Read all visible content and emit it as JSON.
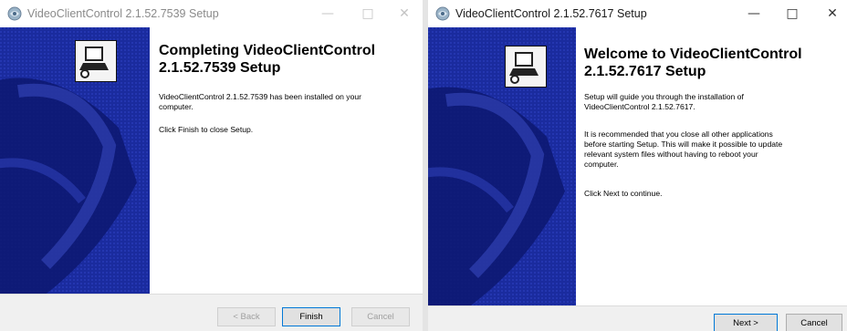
{
  "left_window": {
    "title": "VideoClientControl 2.1.52.7539 Setup",
    "minimize": "—",
    "maximize": "□",
    "close": "✕",
    "heading_line1": "Completing VideoClientControl",
    "heading_line2": "2.1.52.7539 Setup",
    "paragraph1_line1": "VideoClientControl 2.1.52.7539 has been installed on your",
    "paragraph1_line2": "computer.",
    "paragraph2": "Click Finish to close Setup.",
    "back_button": "< Back",
    "finish_button": "Finish",
    "cancel_button": "Cancel"
  },
  "right_window": {
    "title": "VideoClientControl 2.1.52.7617 Setup",
    "minimize": "—",
    "maximize": "□",
    "close": "✕",
    "heading_line1": "Welcome to VideoClientControl",
    "heading_line2": "2.1.52.7617 Setup",
    "paragraph1_line1": "Setup will guide you through the installation of",
    "paragraph1_line2": "VideoClientControl 2.1.52.7617.",
    "paragraph2_line1": "It is recommended that you close all other applications",
    "paragraph2_line2": "before starting Setup. This will make it possible to update",
    "paragraph2_line3": "relevant system files without having to reboot your",
    "paragraph2_line4": "computer.",
    "paragraph3": "Click Next to continue.",
    "next_button": "Next >",
    "cancel_button": "Cancel"
  },
  "colors": {
    "sidebar_blue": "#1a2b9e",
    "sidebar_dark": "#0d1870",
    "default_button_border": "#0078d7"
  }
}
